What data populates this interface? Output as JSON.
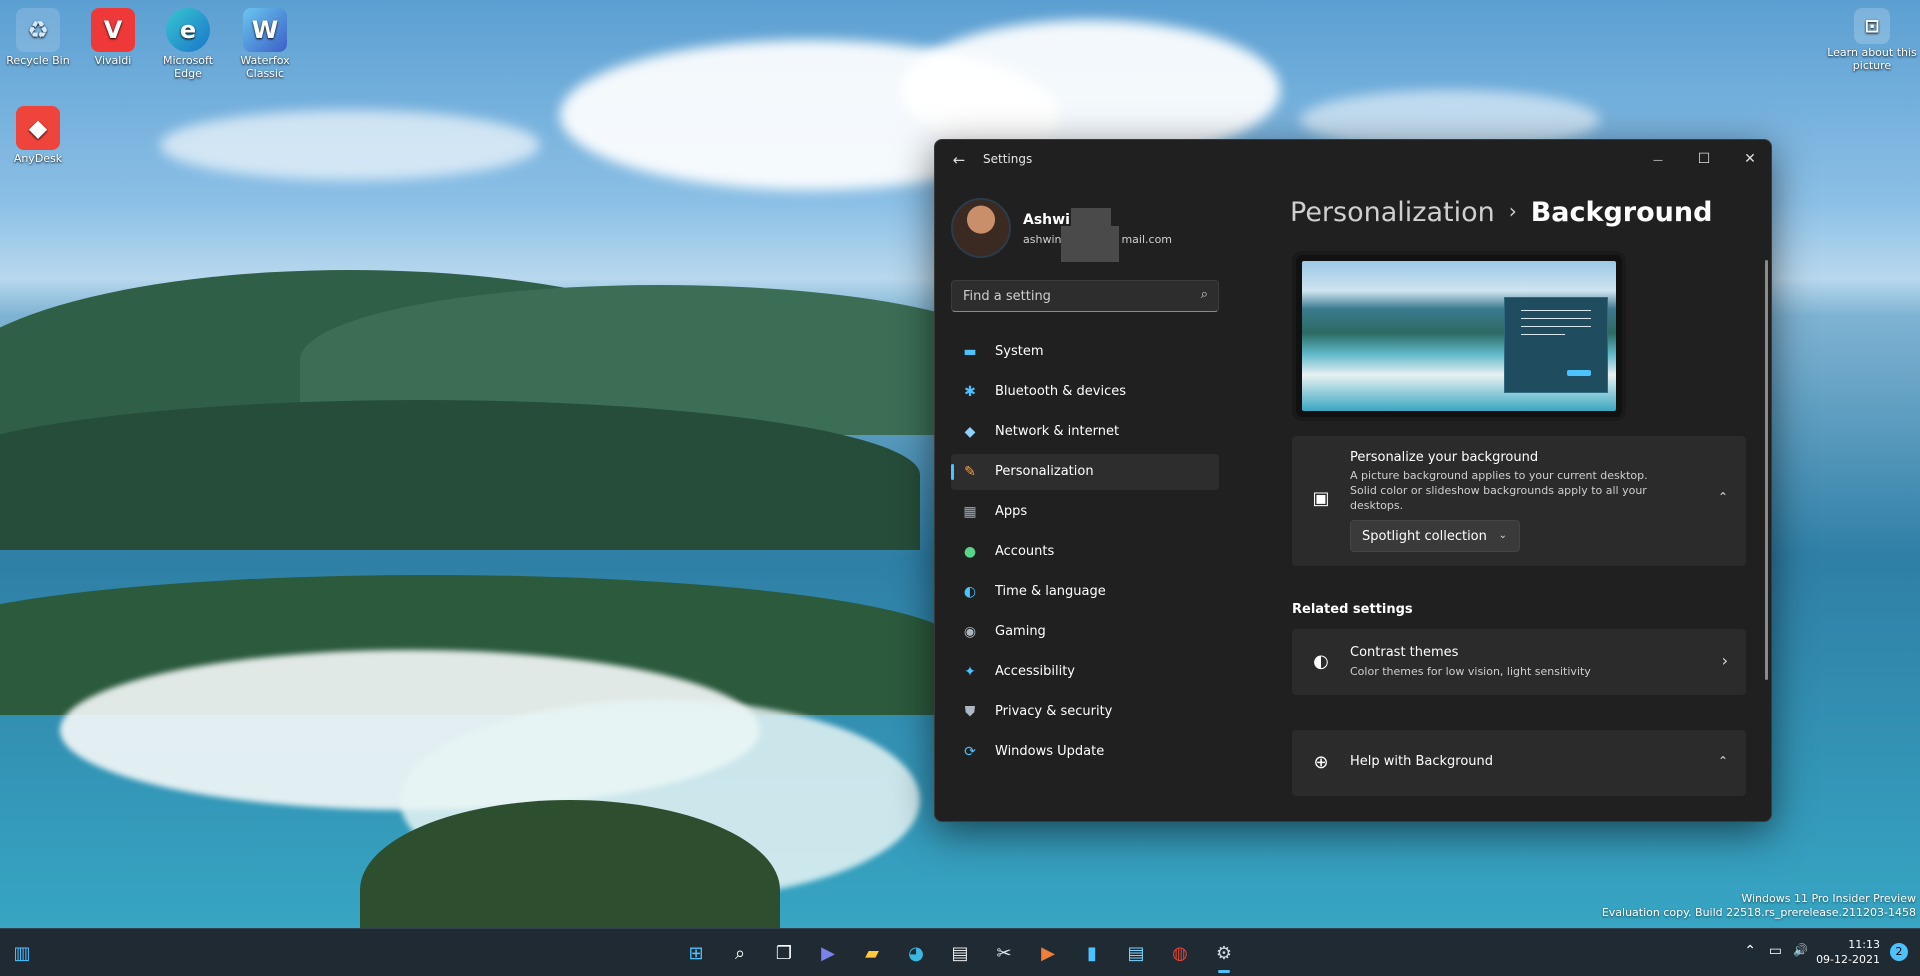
{
  "desktop": {
    "icons": [
      {
        "label": "Recycle Bin",
        "icon": "recycle-bin-icon"
      },
      {
        "label": "Vivaldi",
        "icon": "vivaldi-icon"
      },
      {
        "label": "Microsoft Edge",
        "icon": "edge-icon"
      },
      {
        "label": "Waterfox Classic",
        "icon": "waterfox-icon"
      },
      {
        "label": "AnyDesk",
        "icon": "anydesk-icon"
      }
    ],
    "learn_about": "Learn about this picture"
  },
  "window": {
    "title": "Settings",
    "back_glyph": "←",
    "minimize_glyph": "—",
    "maximize_glyph": "☐",
    "close_glyph": "✕"
  },
  "profile": {
    "name": "Ashwin",
    "email_prefix": "ashwin",
    "email_suffix": "mail.com"
  },
  "search": {
    "placeholder": "Find a setting",
    "glyph": "⌕"
  },
  "nav": [
    {
      "label": "System",
      "icon": "system-icon",
      "glyph": "▬",
      "color": "#4cc2ff"
    },
    {
      "label": "Bluetooth & devices",
      "icon": "bluetooth-icon",
      "glyph": "✱",
      "color": "#4cc2ff"
    },
    {
      "label": "Network & internet",
      "icon": "wifi-icon",
      "glyph": "◆",
      "color": "#8fd0ff"
    },
    {
      "label": "Personalization",
      "icon": "brush-icon",
      "glyph": "✎",
      "color": "#f0a050"
    },
    {
      "label": "Apps",
      "icon": "apps-icon",
      "glyph": "▦",
      "color": "#9aa7b3"
    },
    {
      "label": "Accounts",
      "icon": "accounts-icon",
      "glyph": "●",
      "color": "#5cd38a"
    },
    {
      "label": "Time & language",
      "icon": "globe-icon",
      "glyph": "◐",
      "color": "#4cc2ff"
    },
    {
      "label": "Gaming",
      "icon": "gamepad-icon",
      "glyph": "◉",
      "color": "#aeb8c2"
    },
    {
      "label": "Accessibility",
      "icon": "accessibility-icon",
      "glyph": "✦",
      "color": "#4cc2ff"
    },
    {
      "label": "Privacy & security",
      "icon": "shield-icon",
      "glyph": "⛊",
      "color": "#aeb8c2"
    },
    {
      "label": "Windows Update",
      "icon": "update-icon",
      "glyph": "⟳",
      "color": "#4cc2ff"
    }
  ],
  "active_nav": "Personalization",
  "breadcrumb": {
    "parent": "Personalization",
    "separator": "›",
    "current": "Background"
  },
  "personalize_card": {
    "title": "Personalize your background",
    "description": "A picture background applies to your current desktop. Solid color or slideshow backgrounds apply to all your desktops.",
    "dropdown_value": "Spotlight collection",
    "dropdown_glyph": "⌄",
    "chevron_glyph": "⌃",
    "icon_glyph": "▣"
  },
  "related_settings": {
    "heading": "Related settings",
    "contrast_title": "Contrast themes",
    "contrast_desc": "Color themes for low vision, light sensitivity",
    "contrast_icon_glyph": "◐",
    "contrast_chevron_glyph": "›"
  },
  "help_card": {
    "title": "Help with Background",
    "icon_glyph": "⊕",
    "chevron_glyph": "⌃"
  },
  "watermark": {
    "line1": "Windows 11 Pro Insider Preview",
    "line2": "Evaluation copy. Build 22518.rs_prerelease.211203-1458"
  },
  "taskbar": {
    "apps": [
      {
        "name": "start-icon",
        "glyph": "⊞",
        "color": "#4cc2ff"
      },
      {
        "name": "search-icon",
        "glyph": "⌕",
        "color": "#ffffff"
      },
      {
        "name": "task-view-icon",
        "glyph": "❐",
        "color": "#ffffff"
      },
      {
        "name": "chat-icon",
        "glyph": "▶",
        "color": "#7b83eb"
      },
      {
        "name": "file-explorer-icon",
        "glyph": "▰",
        "color": "#ffc83d"
      },
      {
        "name": "edge-icon",
        "glyph": "◕",
        "color": "#3bb8e0"
      },
      {
        "name": "store-icon",
        "glyph": "▤",
        "color": "#e8e8e8"
      },
      {
        "name": "snipping-tool-icon",
        "glyph": "✂",
        "color": "#e8e8e8"
      },
      {
        "name": "media-player-icon",
        "glyph": "▶",
        "color": "#f07f3c"
      },
      {
        "name": "bookmark-app-icon",
        "glyph": "▮",
        "color": "#4cc2ff"
      },
      {
        "name": "notepad-icon",
        "glyph": "▤",
        "color": "#7fd4ff"
      },
      {
        "name": "chrome-icon",
        "glyph": "◍",
        "color": "#ea4335"
      },
      {
        "name": "settings-icon",
        "glyph": "⚙",
        "color": "#cfd8df"
      }
    ],
    "clock_time": "11:13",
    "clock_date": "09-12-2021",
    "notification_count": "2",
    "tray_up_glyph": "⌃",
    "tray_network_glyph": "▭",
    "tray_volume_glyph": "🔊"
  },
  "colors": {
    "accent": "#4cc2ff",
    "window_bg": "#202020",
    "card_bg": "#2b2b2b"
  }
}
